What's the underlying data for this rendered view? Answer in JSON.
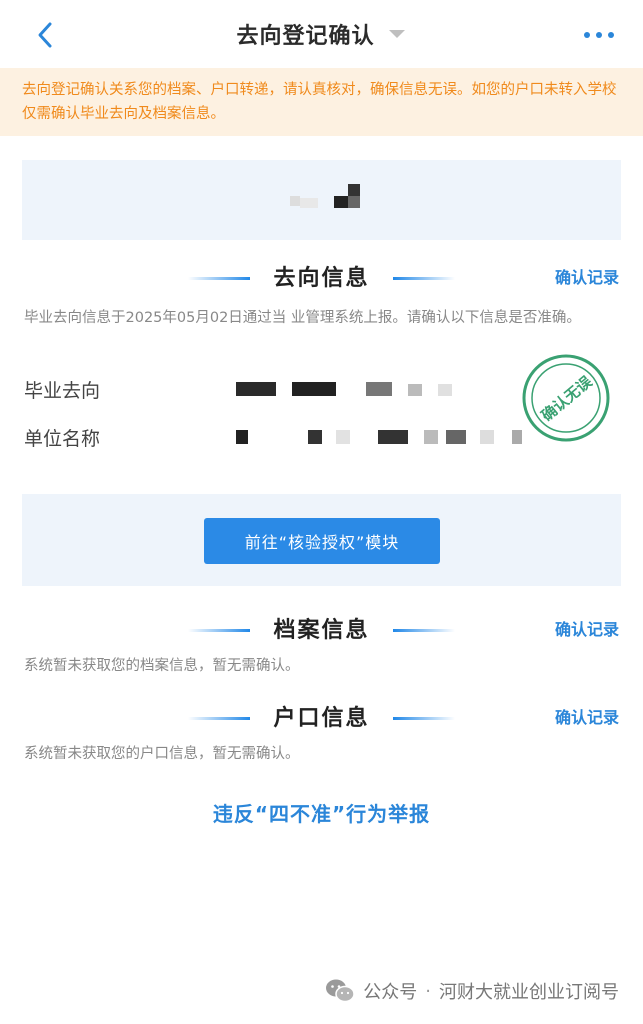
{
  "header": {
    "title": "去向登记确认"
  },
  "notice": {
    "text": "去向登记确认关系您的档案、户口转递，请认真核对，确保信息无误。如您的户口未转入学校仅需确认毕业去向及档案信息。"
  },
  "destination_section": {
    "title": "去向信息",
    "record_link": "确认记录",
    "description": "毕业去向信息于2025年05月02日通过当      业管理系统上报。请确认以下信息是否准确。",
    "fields": [
      {
        "label": "毕业去向"
      },
      {
        "label": "单位名称"
      }
    ],
    "stamp_text": "确认无误"
  },
  "action": {
    "button_label": "前往“核验授权”模块"
  },
  "archive_section": {
    "title": "档案信息",
    "record_link": "确认记录",
    "description": "系统暂未获取您的档案信息，暂无需确认。"
  },
  "hukou_section": {
    "title": "户口信息",
    "record_link": "确认记录",
    "description": "系统暂未获取您的户口信息，暂无需确认。"
  },
  "report": {
    "label": "违反“四不准”行为举报"
  },
  "footer": {
    "prefix": "公众号",
    "separator": "·",
    "account": "河财大就业创业订阅号"
  },
  "colors": {
    "accent": "#2b8ae6",
    "notice_text": "#f08a1c",
    "notice_bg": "#fdf1e1",
    "stamp": "#3aa172"
  }
}
